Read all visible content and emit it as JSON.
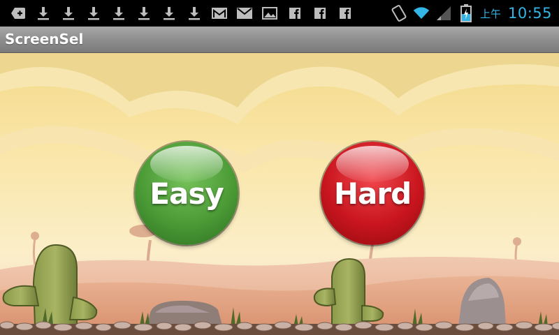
{
  "status_bar": {
    "notifications": [
      "add-icon",
      "download-icon",
      "download-icon",
      "download-icon",
      "download-icon",
      "download-icon",
      "download-icon",
      "download-icon",
      "gmail-icon",
      "email-icon",
      "image-icon",
      "facebook-icon",
      "facebook-icon",
      "facebook-icon"
    ],
    "system_icons": [
      "rotation-icon",
      "wifi-icon",
      "signal-icon",
      "battery-charging-icon"
    ],
    "ampm": "上午",
    "time": "10:55",
    "time_color": "#33b5e5"
  },
  "app": {
    "title": "ScreenSel"
  },
  "buttons": {
    "easy": {
      "label": "Easy",
      "color": "#4a9a36"
    },
    "hard": {
      "label": "Hard",
      "color": "#c9151e"
    }
  }
}
